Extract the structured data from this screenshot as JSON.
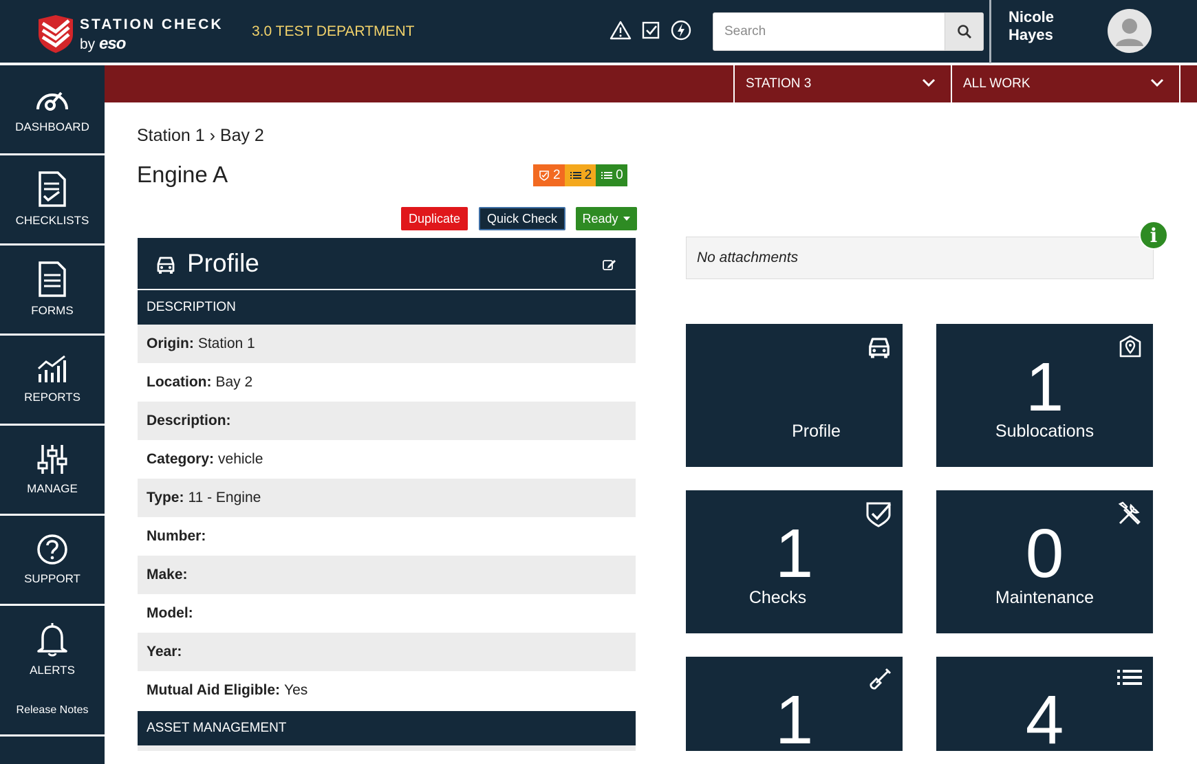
{
  "header": {
    "brand_line1": "STATION CHECK",
    "brand_by": "by",
    "brand_eso": "eso",
    "department": "3.0 TEST DEPARTMENT",
    "icons": [
      "warning-icon",
      "checkbox-icon",
      "bolt-icon"
    ],
    "search_placeholder": "Search",
    "user_name": "Nicole Hayes"
  },
  "filters": {
    "station": "STATION 3",
    "work": "ALL WORK"
  },
  "sidebar": {
    "items": [
      {
        "label": "DASHBOARD",
        "icon": "gauge-icon"
      },
      {
        "label": "CHECKLISTS",
        "icon": "checklist-icon"
      },
      {
        "label": "FORMS",
        "icon": "form-icon"
      },
      {
        "label": "REPORTS",
        "icon": "reports-icon"
      },
      {
        "label": "MANAGE",
        "icon": "sliders-icon"
      },
      {
        "label": "SUPPORT",
        "icon": "question-icon"
      },
      {
        "label": "ALERTS",
        "icon": "bell-icon"
      },
      {
        "label": "Release Notes",
        "icon": ""
      }
    ]
  },
  "main": {
    "breadcrumb": "Station 1 › Bay 2",
    "title": "Engine A",
    "badges": [
      {
        "count": "2",
        "color": "#f26a21",
        "icon": "shield-check-icon"
      },
      {
        "count": "2",
        "color": "#f4a81d",
        "icon": "list-icon"
      },
      {
        "count": "0",
        "color": "#2e8b23",
        "icon": "list-icon"
      }
    ],
    "buttons": {
      "duplicate": "Duplicate",
      "quick_check": "Quick Check",
      "ready": "Ready"
    },
    "profile": {
      "title": "Profile",
      "section_description": "DESCRIPTION",
      "rows": [
        {
          "label": "Origin:",
          "value": "Station 1"
        },
        {
          "label": "Location:",
          "value": "Bay 2"
        },
        {
          "label": "Description:",
          "value": ""
        },
        {
          "label": "Category:",
          "value": "vehicle"
        },
        {
          "label": "Type:",
          "value": "11 - Engine"
        },
        {
          "label": "Number:",
          "value": ""
        },
        {
          "label": "Make:",
          "value": ""
        },
        {
          "label": "Model:",
          "value": ""
        },
        {
          "label": "Year:",
          "value": ""
        },
        {
          "label": "Mutual Aid Eligible:",
          "value": "Yes"
        }
      ],
      "section_asset": "ASSET MANAGEMENT"
    }
  },
  "right": {
    "attachments": "No attachments",
    "info_glyph": "i",
    "tiles": [
      {
        "label": "Profile",
        "count": "",
        "icon": "truck-icon"
      },
      {
        "label": "Sublocations",
        "count": "1",
        "icon": "map-pin-icon"
      },
      {
        "label": "Checks",
        "count": "1",
        "icon": "shield-check-icon"
      },
      {
        "label": "Maintenance",
        "count": "0",
        "icon": "tools-icon"
      },
      {
        "label": "",
        "count": "1",
        "icon": "shovel-icon"
      },
      {
        "label": "",
        "count": "4",
        "icon": "list-icon"
      }
    ]
  },
  "colors": {
    "navy": "#14293a",
    "maroon": "#7a181b",
    "gold": "#f3d36b",
    "red": "#e0171b",
    "green": "#2e8b23",
    "orange": "#f26a21",
    "amber": "#f4a81d"
  }
}
